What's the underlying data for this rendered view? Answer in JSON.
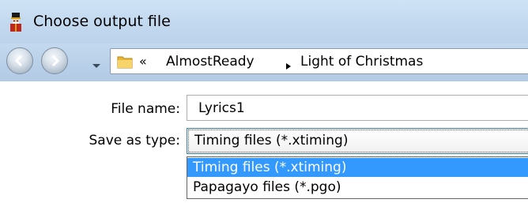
{
  "window": {
    "title": "Choose output file",
    "app_icon": "nutcracker-icon"
  },
  "navigation": {
    "back_icon": "back-arrow-icon",
    "forward_icon": "forward-arrow-icon",
    "recent_icon": "chevron-down-icon",
    "breadcrumb": {
      "folder_icon": "folder-icon",
      "overflow": "«",
      "items": [
        "AlmostReady",
        "Light of Christmas"
      ],
      "separator_icon": "triangle-right-icon"
    }
  },
  "form": {
    "file_name": {
      "label": "File name:",
      "value": "Lyrics1"
    },
    "save_as_type": {
      "label": "Save as type:",
      "selected": "Timing files (*.xtiming)",
      "options": [
        "Timing files (*.xtiming)",
        "Papagayo files (*.pgo)"
      ],
      "highlighted_index": 0
    }
  },
  "colors": {
    "titlebar": "#c3d9ef",
    "highlight": "#3399ff",
    "focus_border": "#3c7fb1"
  }
}
